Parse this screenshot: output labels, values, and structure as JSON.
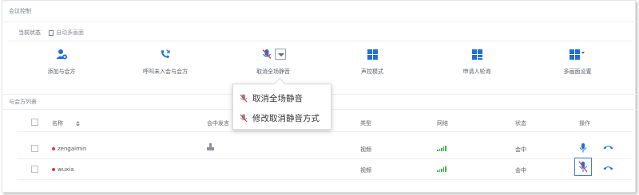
{
  "header": {
    "section_title": "会议控制"
  },
  "status": {
    "status_label": "当前状态",
    "layout_label": "自动多画面"
  },
  "toolbar": {
    "items": [
      {
        "label": "添加与会方",
        "icon": "add-user-icon"
      },
      {
        "label": "呼叫未入会与会方",
        "icon": "call-icon"
      },
      {
        "label": "取消全场静音",
        "icon": "mic-muted-icon"
      },
      {
        "label": "声控模式",
        "icon": "grid-icon"
      },
      {
        "label": "申请人轮询",
        "icon": "grid-icon"
      },
      {
        "label": "多画面设置",
        "icon": "grid-icon"
      }
    ]
  },
  "popup": {
    "items": [
      {
        "label": "取消全场静音",
        "icon": "mic-muted-icon"
      },
      {
        "label": "修改取消静音方式",
        "icon": "mic-muted-icon"
      }
    ]
  },
  "participants": {
    "title": "与会方列表",
    "columns": {
      "name": "名称",
      "speaker": "会中发言",
      "type": "类型",
      "network": "网络",
      "status": "状态",
      "action": "操作"
    },
    "rows": [
      {
        "name": "zengaimin",
        "type": "视频",
        "status": "会中"
      },
      {
        "name": "wuxia",
        "type": "视频",
        "status": "会中"
      }
    ]
  },
  "colors": {
    "accent": "#1e6fd9",
    "hangup": "#1e6fd9",
    "signal": "#3bb54a",
    "online_dot": "#e53935"
  }
}
